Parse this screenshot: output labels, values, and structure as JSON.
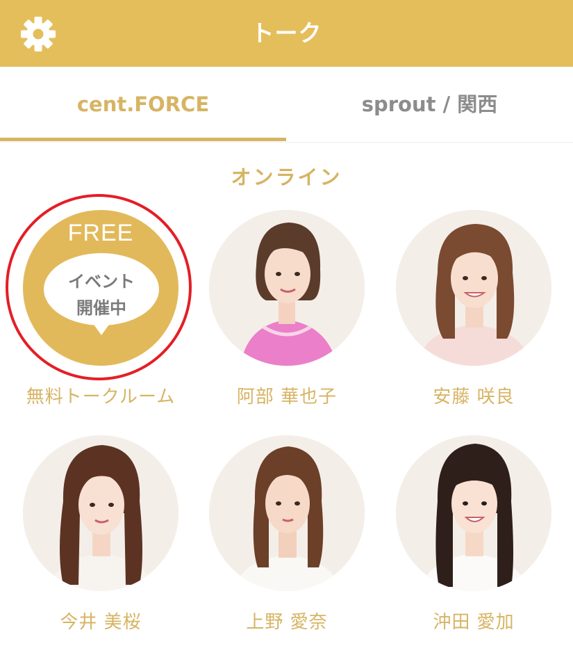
{
  "header": {
    "title": "トーク",
    "settings_icon": "gear-icon",
    "background_color": "#E5BE5C"
  },
  "tabs": [
    {
      "label": "cent.FORCE",
      "active": true
    },
    {
      "label": "sprout / 関西",
      "active": false
    }
  ],
  "section": {
    "title": "オンライン"
  },
  "free_room": {
    "badge": "FREE",
    "bubble_line1": "イベント",
    "bubble_line2": "開催中",
    "name": "無料トークルーム"
  },
  "members": [
    {
      "name": "阿部 華也子"
    },
    {
      "name": "安藤 咲良"
    },
    {
      "name": "今井 美桜"
    },
    {
      "name": "上野 愛奈"
    },
    {
      "name": "沖田 愛加"
    }
  ],
  "colors": {
    "accent": "#D6B463",
    "inactive_tab": "#8C8C8C",
    "highlight_ring": "#E41E26"
  }
}
